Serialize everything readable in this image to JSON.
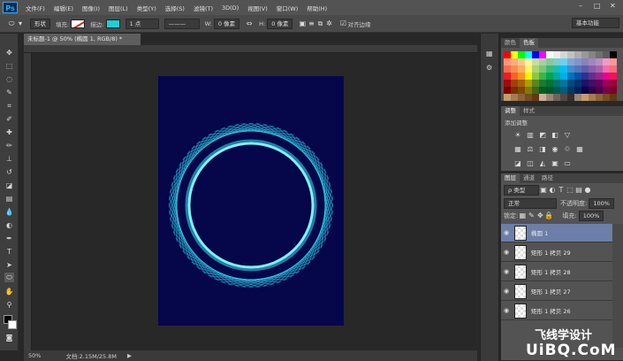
{
  "app": {
    "logo": "Ps"
  },
  "menu": [
    "文件(F)",
    "编辑(E)",
    "图像(I)",
    "图层(L)",
    "类型(Y)",
    "选择(S)",
    "滤镜(T)",
    "3D(D)",
    "视图(V)",
    "窗口(W)",
    "帮助(H)"
  ],
  "options": {
    "shape_mode": "形状",
    "fill_label": "填充:",
    "stroke_label": "描边:",
    "stroke_width": "1 点",
    "w_label": "W:",
    "w_value": "0 像素",
    "h_label": "H:",
    "h_value": "0 像素",
    "align_edges": "对齐边缘",
    "workspace": "基本功能"
  },
  "document": {
    "tab_title": "未标题-1 @ 50% (椭圆 1, RGB/8) *",
    "background_color": "#06064a",
    "ring_color": "#2fd3e8"
  },
  "status": {
    "zoom": "50%",
    "doc_info": "文档:2.15M/25.8M"
  },
  "panels": {
    "color_tabs": [
      "颜色",
      "色板"
    ],
    "adjust_tabs": [
      "调整",
      "样式"
    ],
    "adjust_title": "添加调整",
    "layer_tabs": [
      "图层",
      "通道",
      "路径"
    ],
    "layer_filter": "ρ 类型",
    "blend_mode": "正常",
    "opacity_label": "不透明度:",
    "opacity_value": "100%",
    "lock_label": "锁定:",
    "fill_label": "填充:",
    "fill_value": "100%"
  },
  "layers": [
    {
      "name": "椭圆 1",
      "selected": true
    },
    {
      "name": "矩形 1 拷贝 29",
      "selected": false
    },
    {
      "name": "矩形 1 拷贝 28",
      "selected": false
    },
    {
      "name": "矩形 1 拷贝 27",
      "selected": false
    },
    {
      "name": "矩形 1 拷贝 26",
      "selected": false
    }
  ],
  "watermark": {
    "text": "飞线学设计",
    "site": "UiBQ.CoM"
  }
}
